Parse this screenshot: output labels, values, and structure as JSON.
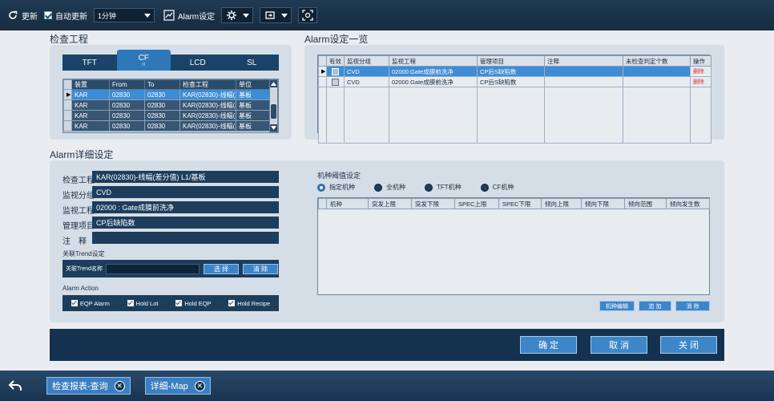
{
  "toolbar": {
    "refresh_label": "更新",
    "auto_refresh_label": "自动更新",
    "interval_value": "1分钟",
    "alarm_setting_label": "Alarm设定"
  },
  "inspect": {
    "title": "检查工程",
    "tabs": [
      "TFT",
      "CF",
      "LCD",
      "SL"
    ],
    "active_tab": "CF",
    "active_tab_sub": "III",
    "columns": [
      "装置",
      "From",
      "To",
      "检查工程",
      "单位"
    ],
    "rows": [
      [
        "KAR",
        "02830",
        "02830",
        "KAR(02830)-线幅(差分...",
        "基板"
      ],
      [
        "KAR",
        "02830",
        "02830",
        "KAR(02830)-线幅(差分...",
        "基板"
      ],
      [
        "KAR",
        "02830",
        "02830",
        "KAR(02830)-线幅(差分...",
        "基板"
      ],
      [
        "KAR",
        "02830",
        "02830",
        "KAR(02830)-线幅(差分...",
        "基板"
      ]
    ]
  },
  "alarm_list": {
    "title": "Alarm设定一览",
    "columns": [
      "有效",
      "监视分组",
      "监视工程",
      "管理项目",
      "注释",
      "未检查判定个数",
      "操作"
    ],
    "rows": [
      {
        "group": "CVD",
        "process": "02000:Gate成膜前洗净",
        "item": "CP后S缺陷数",
        "note": "",
        "count": "",
        "op": "删除"
      },
      {
        "group": "CVD",
        "process": "02000:Gate成膜前洗净",
        "item": "CP后S缺陷数",
        "note": "",
        "count": "",
        "op": "删除"
      }
    ]
  },
  "detail": {
    "title": "Alarm详细设定",
    "fields": [
      {
        "label": "检查工程",
        "value": "KAR(02830)-线幅(差分值) L1/基板"
      },
      {
        "label": "监视分组",
        "value": "CVD"
      },
      {
        "label": "监视工程",
        "value": "02000 : Gate成膜前洗净"
      },
      {
        "label": "管理项目",
        "value": "CP后缺陷数"
      },
      {
        "label": "注　释",
        "value": ""
      }
    ],
    "trend_title": "关联Trend设定",
    "trend_name_label": "关联Trend名称",
    "select_btn": "选 择",
    "clear_btn": "清 除",
    "action_title": "Alarm Action",
    "actions": [
      "EQP Alarm",
      "Hold Lot",
      "Hold EQP",
      "Hold Recipe"
    ]
  },
  "threshold": {
    "title": "机种阈值设定",
    "radios": [
      "指定机种",
      "全机种",
      "TFT机种",
      "CF机种"
    ],
    "columns": [
      "机种",
      "突发上限",
      "突发下限",
      "SPEC上限",
      "SPEC下限",
      "倾向上限",
      "倾向下限",
      "倾向范围",
      "倾向发生数"
    ],
    "edit_btn": "机种编辑",
    "add_btn": "追 加",
    "remove_btn": "消 除"
  },
  "dialog": {
    "ok": "确 定",
    "cancel": "取 消",
    "close": "关 闭"
  },
  "bottom_tabs": [
    "检查报表-查询",
    "详细-Map"
  ]
}
